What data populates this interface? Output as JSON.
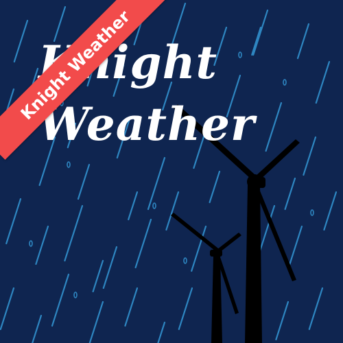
{
  "title": {
    "line1": "Knight",
    "line2": "Weather"
  },
  "ribbon": {
    "label": "Knight Weather"
  },
  "colors": {
    "background": "#0f2550",
    "rain": "#2e86c1",
    "turbine": "#000000",
    "ribbon": "#f24b4b",
    "title_text": "#ffffff"
  },
  "icons": {
    "rain": "rain-streaks",
    "turbine": "wind-turbine"
  }
}
